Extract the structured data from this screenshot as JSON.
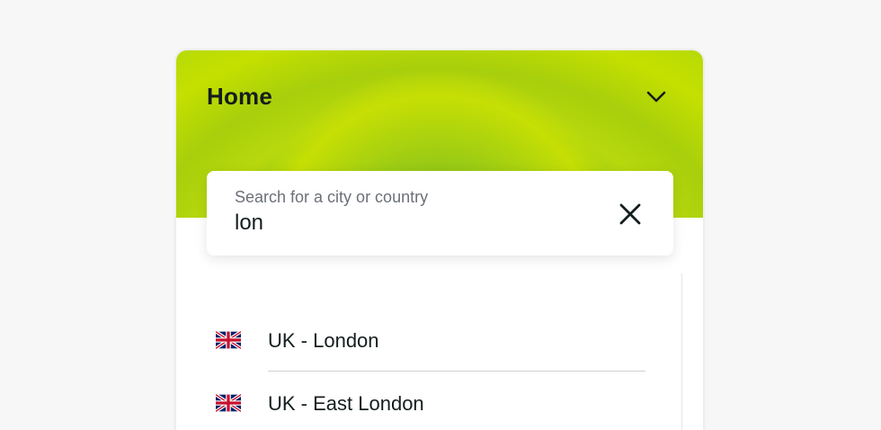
{
  "header": {
    "title": "Home"
  },
  "search": {
    "label": "Search for a city or country",
    "value": "lon"
  },
  "results": [
    {
      "label": "UK - London",
      "flag": "uk-flag-icon"
    },
    {
      "label": "UK - East London",
      "flag": "uk-flag-icon"
    }
  ],
  "colors": {
    "accent_green": "#c4e000",
    "text_dark": "#141d1e",
    "label_gray": "#6b7077"
  }
}
